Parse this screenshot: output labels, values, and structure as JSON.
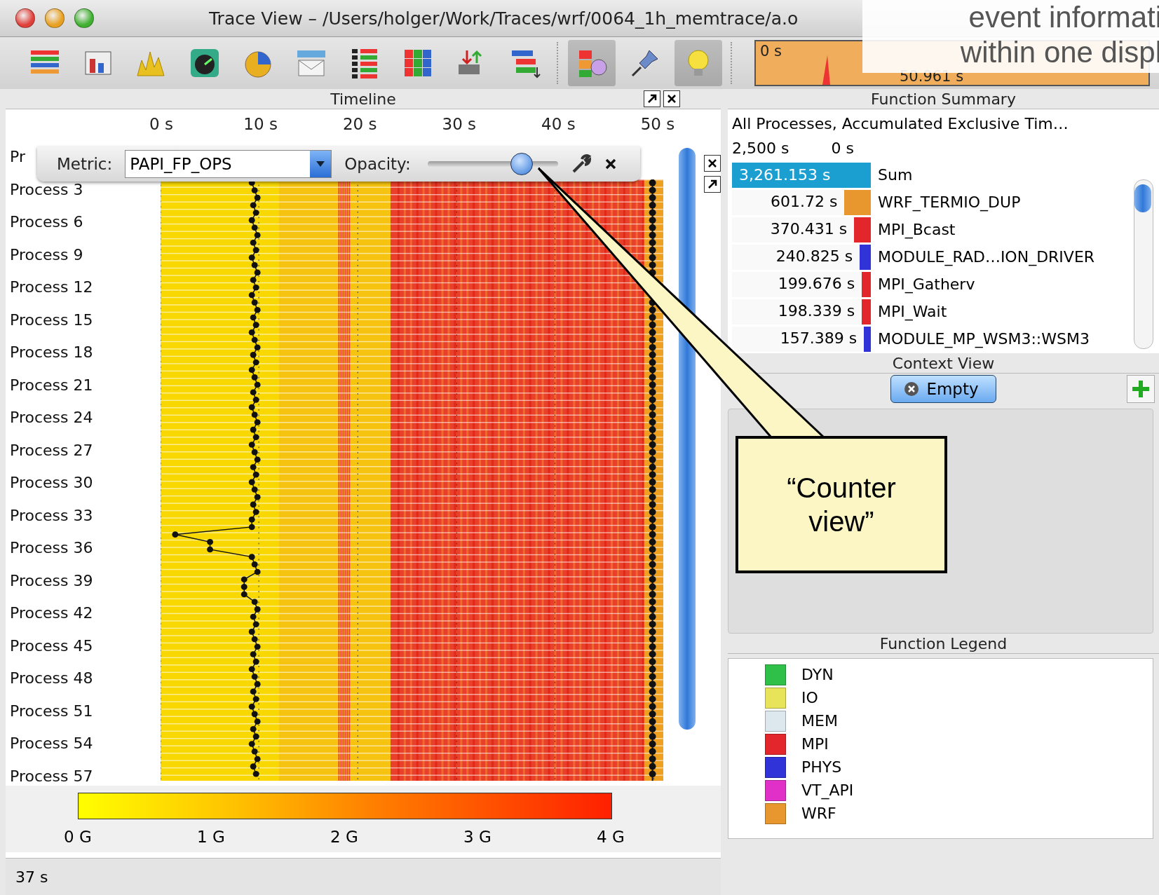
{
  "window": {
    "title": "Trace View – /Users/holger/Work/Traces/wrf/0064_1h_memtrace/a.o"
  },
  "slide_caption": [
    "event informati",
    "within one displ"
  ],
  "toolbar_buttons": [
    {
      "kind": "timeline",
      "pressed": false
    },
    {
      "kind": "process",
      "pressed": false
    },
    {
      "kind": "counter",
      "pressed": false
    },
    {
      "kind": "gauge",
      "pressed": false
    },
    {
      "kind": "pie",
      "pressed": false
    },
    {
      "kind": "message",
      "pressed": false
    },
    {
      "kind": "summary",
      "pressed": false
    },
    {
      "kind": "matrix",
      "pressed": false
    },
    {
      "kind": "io",
      "pressed": false
    },
    {
      "kind": "tree",
      "pressed": false
    },
    {
      "kind": "palette",
      "pressed": true
    },
    {
      "kind": "pin",
      "pressed": false
    },
    {
      "kind": "bulb",
      "pressed": true
    }
  ],
  "overview": {
    "start": "0 s",
    "end": "50.961 s"
  },
  "timeline": {
    "title": "Timeline",
    "ticks": [
      "0 s",
      "10 s",
      "20 s",
      "30 s",
      "40 s",
      "50 s"
    ],
    "processes": [
      "Pr",
      "Process 3",
      "Process 6",
      "Process 9",
      "Process 12",
      "Process 15",
      "Process 18",
      "Process 21",
      "Process 24",
      "Process 27",
      "Process 30",
      "Process 33",
      "Process 36",
      "Process 39",
      "Process 42",
      "Process 45",
      "Process 48",
      "Process 51",
      "Process 54",
      "Process 57"
    ],
    "metric_label": "Metric:",
    "metric": "PAPI_FP_OPS",
    "opacity_label": "Opacity:",
    "opacity": {
      "level": 0.72
    },
    "scale_ticks": [
      "0 G",
      "1 G",
      "2 G",
      "3 G",
      "4 G"
    ]
  },
  "function_summary": {
    "title": "Function Summary",
    "subtitle": "All Processes, Accumulated Exclusive Tim…",
    "axis": [
      "2,500 s",
      "0 s"
    ],
    "rows": [
      {
        "kind": "total",
        "value": "3,261.153 s",
        "name": "Sum",
        "color": "#1a9fd0",
        "level": 1
      },
      {
        "kind": "item",
        "value": "601.72 s",
        "name": "WRF_TERMIO_DUP",
        "color": "#e8962e",
        "level": 0.19
      },
      {
        "kind": "item",
        "value": "370.431 s",
        "name": "MPI_Bcast",
        "color": "#e2262b",
        "level": 0.12
      },
      {
        "kind": "item",
        "value": "240.825 s",
        "name": "MODULE_RAD…ION_DRIVER",
        "color": "#2f33d8",
        "level": 0.08
      },
      {
        "kind": "item",
        "value": "199.676 s",
        "name": "MPI_Gatherv",
        "color": "#e2262b",
        "level": 0.065
      },
      {
        "kind": "item",
        "value": "198.339 s",
        "name": "MPI_Wait",
        "color": "#e2262b",
        "level": 0.065
      },
      {
        "kind": "item",
        "value": "157.389 s",
        "name": "MODULE_MP_WSM3::WSM3",
        "color": "#2f33d8",
        "level": 0.05
      }
    ]
  },
  "context_view": {
    "title": "Context View",
    "button": "Empty"
  },
  "function_legend": {
    "title": "Function Legend",
    "items": [
      {
        "name": "DYN",
        "color": "#2fc04a"
      },
      {
        "name": "IO",
        "color": "#e8e45a"
      },
      {
        "name": "MEM",
        "color": "#dce8ee"
      },
      {
        "name": "MPI",
        "color": "#e2262b"
      },
      {
        "name": "PHYS",
        "color": "#2f33d8"
      },
      {
        "name": "VT_API",
        "color": "#e030c8"
      },
      {
        "name": "WRF",
        "color": "#e8962e"
      }
    ]
  },
  "status_bar": "37 s",
  "callout": "“Counter view”"
}
